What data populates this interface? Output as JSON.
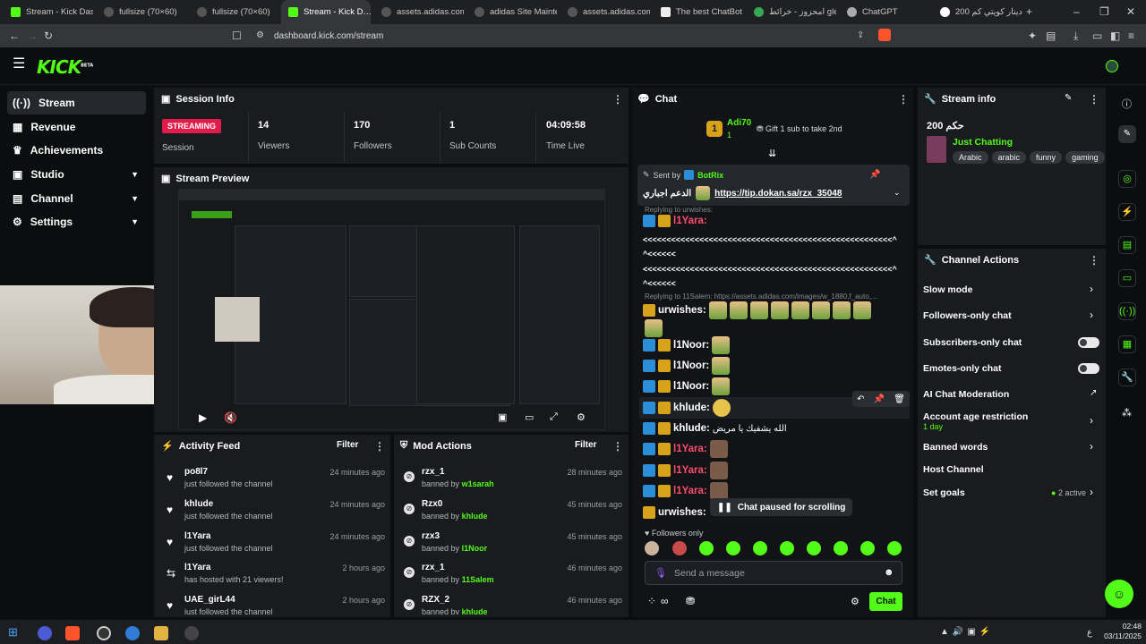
{
  "browser": {
    "tabs": [
      "Stream - Kick Dashb…",
      "fullsize (70×60)",
      "fullsize (70×60)",
      "Stream - Kick D…",
      "assets.adidas.com",
      "adidas Site Mainten…",
      "assets.adidas.com",
      "The best ChatBot ar…",
      "امحزوز - خرائط gle",
      "ChatGPT",
      "200 دينار كويتي كم…"
    ],
    "url": "dashboard.kick.com/stream"
  },
  "kick": {
    "logo": "KICK",
    "beta": "BETA"
  },
  "sidebar": {
    "items": [
      {
        "label": "Stream",
        "icon": "stream-icon"
      },
      {
        "label": "Revenue",
        "icon": "revenue-icon"
      },
      {
        "label": "Achievements",
        "icon": "trophy-icon"
      },
      {
        "label": "Studio",
        "icon": "studio-icon"
      },
      {
        "label": "Channel",
        "icon": "channel-icon"
      },
      {
        "label": "Settings",
        "icon": "gear-icon"
      }
    ]
  },
  "session": {
    "title": "Session Info",
    "status": "STREAMING",
    "status_label": "Session",
    "stats": [
      {
        "value": "14",
        "label": "Viewers"
      },
      {
        "value": "170",
        "label": "Followers"
      },
      {
        "value": "1",
        "label": "Sub Counts"
      },
      {
        "value": "04:09:58",
        "label": "Time Live"
      }
    ]
  },
  "preview": {
    "title": "Stream Preview"
  },
  "activity": {
    "title": "Activity Feed",
    "filter": "Filter",
    "items": [
      {
        "name": "po8l7",
        "desc": "just followed the channel",
        "time": "24 minutes ago",
        "icon": "heart-icon"
      },
      {
        "name": "khlude",
        "desc": "just followed the channel",
        "time": "24 minutes ago",
        "icon": "heart-icon"
      },
      {
        "name": "l1Yara",
        "desc": "just followed the channel",
        "time": "24 minutes ago",
        "icon": "heart-icon"
      },
      {
        "name": "l1Yara",
        "desc": "has hosted with 21 viewers!",
        "time": "2 hours ago",
        "icon": "host-icon"
      },
      {
        "name": "UAE_girL44",
        "desc": "just followed the channel",
        "time": "2 hours ago",
        "icon": "heart-icon"
      }
    ]
  },
  "mod": {
    "title": "Mod Actions",
    "filter": "Filter",
    "items": [
      {
        "name": "rzx_1",
        "prefix": "banned by",
        "by": "w1sarah",
        "time": "28 minutes ago"
      },
      {
        "name": "Rzx0",
        "prefix": "banned by",
        "by": "khlude",
        "time": "45 minutes ago"
      },
      {
        "name": "rzx3",
        "prefix": "banned by",
        "by": "l1Noor",
        "time": "45 minutes ago"
      },
      {
        "name": "rzx_1",
        "prefix": "banned by",
        "by": "11Salem",
        "time": "46 minutes ago"
      },
      {
        "name": "RZX_2",
        "prefix": "banned by",
        "by": "khlude",
        "time": "46 minutes ago"
      }
    ]
  },
  "chat": {
    "title": "Chat",
    "gift_user": "Adi70",
    "gift_count": "1",
    "gift_text": "Gift 1 sub to take 2nd",
    "pinned_sent_by": "Sent by",
    "pinned_bot": "BotRix",
    "pinned_text": "الدعم اجباري",
    "pinned_link": "https://tip.dokan.sa/rzx_35048",
    "reply1": "Replying to urwishes:",
    "reply2": "Replying to 11Salem: https://assets.adidas.com/images/w_1880,f_auto,...",
    "lines": [
      {
        "user": "l1Yara:",
        "color": "#ff4d6d",
        "text": ""
      },
      {
        "user": "urwishes:",
        "color": "#ffffff",
        "text": ""
      },
      {
        "user": "l1Noor:",
        "color": "#ffffff",
        "text": ""
      },
      {
        "user": "l1Noor:",
        "color": "#ffffff",
        "text": ""
      },
      {
        "user": "l1Noor:",
        "color": "#ffffff",
        "text": ""
      },
      {
        "user": "khlude:",
        "color": "#ffffff",
        "text": ""
      },
      {
        "user": "khlude:",
        "color": "#ffffff",
        "text": "الله يشفيك يا مريض"
      },
      {
        "user": "l1Yara:",
        "color": "#ff4d6d",
        "text": ""
      },
      {
        "user": "l1Yara:",
        "color": "#ff4d6d",
        "text": ""
      },
      {
        "user": "l1Yara:",
        "color": "#ff4d6d",
        "text": ""
      },
      {
        "user": "urwishes:",
        "color": "#ffffff",
        "text": ""
      }
    ],
    "spam1": "<<<<<<<<<<<<<<<<<<<<<<<<<<<<<<<<<<<<<<<<<<<<<<<<<<<<<^",
    "spam1b": "^<<<<<<",
    "paused": "Chat paused for scrolling",
    "followers_only": "Followers only",
    "placeholder": "Send a message",
    "send": "Chat"
  },
  "streaminfo": {
    "title": "Stream info",
    "stream_title": "200 حكم",
    "category": "Just Chatting",
    "tags": [
      "Arabic",
      "arabic",
      "funny",
      "gaming"
    ]
  },
  "actions": {
    "title": "Channel Actions",
    "items": [
      {
        "label": "Slow mode",
        "control": "chevron"
      },
      {
        "label": "Followers-only chat",
        "control": "chevron"
      },
      {
        "label": "Subscribers-only chat",
        "control": "toggle"
      },
      {
        "label": "Emotes-only chat",
        "control": "toggle"
      },
      {
        "label": "AI Chat Moderation",
        "control": "external"
      },
      {
        "label": "Account age restriction",
        "sub": "1 day",
        "control": "chevron"
      },
      {
        "label": "Banned words",
        "control": "chevron"
      },
      {
        "label": "Host Channel",
        "control": "none"
      },
      {
        "label": "Set goals",
        "sub": "2 active",
        "control": "chevron"
      }
    ]
  },
  "taskbar": {
    "time": "02:48",
    "date": "03/11/2025",
    "lang": "ع"
  }
}
